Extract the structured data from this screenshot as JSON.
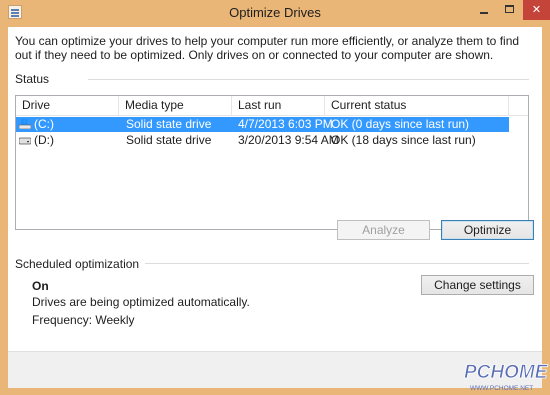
{
  "window": {
    "title": "Optimize Drives",
    "minimize_glyph": "",
    "close_glyph": "✕"
  },
  "intro": "You can optimize your drives to help your computer run more efficiently, or analyze them to find out if they need to be optimized. Only drives on or connected to your computer are shown.",
  "status": {
    "label": "Status",
    "columns": [
      "Drive",
      "Media type",
      "Last run",
      "Current status"
    ],
    "rows": [
      {
        "drive": "(C:)",
        "media_type": "Solid state drive",
        "last_run": "4/7/2013 6:03 PM",
        "current_status": "OK (0 days since last run)",
        "selected": true,
        "icon": "windows-drive-icon"
      },
      {
        "drive": "(D:)",
        "media_type": "Solid state drive",
        "last_run": "3/20/2013 9:54 AM",
        "current_status": "OK (18 days since last run)",
        "selected": false,
        "icon": "hard-drive-icon"
      }
    ],
    "analyze_label": "Analyze",
    "optimize_label": "Optimize"
  },
  "scheduled": {
    "label": "Scheduled optimization",
    "state": "On",
    "description": "Drives are being optimized automatically.",
    "frequency": "Frequency: Weekly",
    "change_settings_label": "Change settings"
  },
  "watermark": {
    "brand": "PCHOME",
    "url": "WWW.PCHOME.NET"
  },
  "colors": {
    "titlebar": "#e9b678",
    "selection": "#3399ff",
    "close_button": "#c5443a"
  }
}
